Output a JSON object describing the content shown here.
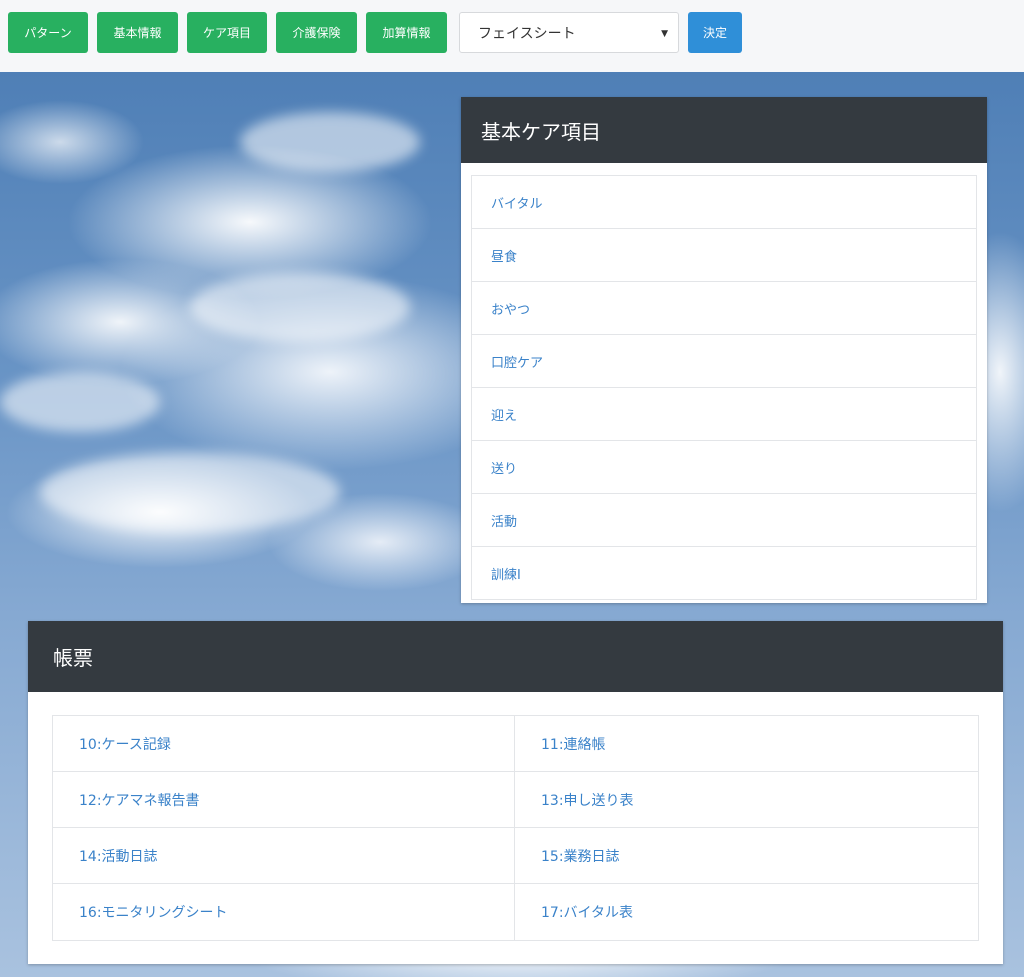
{
  "toolbar": {
    "buttons": [
      {
        "label": "パターン"
      },
      {
        "label": "基本情報"
      },
      {
        "label": "ケア項目"
      },
      {
        "label": "介護保険"
      },
      {
        "label": "加算情報"
      }
    ],
    "select_value": "フェイスシート",
    "decide_label": "決定",
    "colors": {
      "green": "#28b060",
      "blue": "#2f8fd8"
    }
  },
  "care_panel": {
    "title": "基本ケア項目",
    "items": [
      "バイタル",
      "昼食",
      "おやつ",
      "口腔ケア",
      "迎え",
      "送り",
      "活動",
      "訓練Ⅰ"
    ]
  },
  "forms_panel": {
    "title": "帳票",
    "items": [
      "10:ケース記録",
      "11:連絡帳",
      "12:ケアマネ報告書",
      "13:申し送り表",
      "14:活動日誌",
      "15:業務日誌",
      "16:モニタリングシート",
      "17:バイタル表"
    ]
  },
  "icons": {
    "select_caret": "caret-down-icon"
  }
}
